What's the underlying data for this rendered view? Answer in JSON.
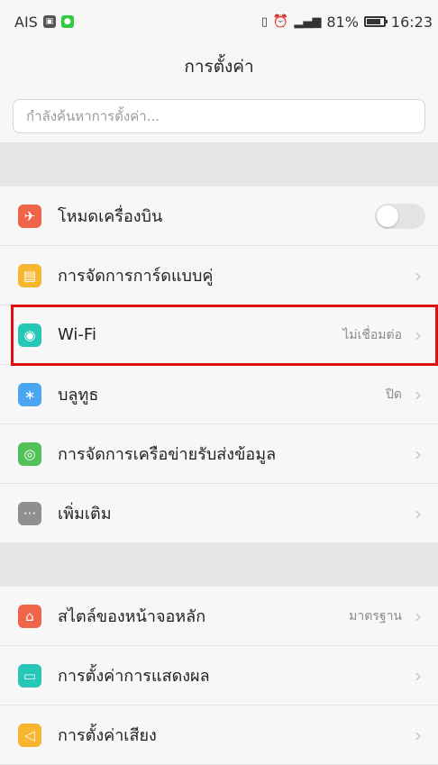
{
  "status": {
    "carrier": "AIS",
    "battery": "81%",
    "time": "16:23",
    "battery_fraction": 0.81
  },
  "header": {
    "title": "การตั้งค่า"
  },
  "search": {
    "placeholder": "กำลังค้นหาการตั้งค่า..."
  },
  "groups": [
    [
      {
        "name": "airplane",
        "label": "โหมดเครื่องบิน",
        "icon": "airplane-icon",
        "color": "#f0654a",
        "glyph": "✈",
        "toggle": true,
        "toggle_on": false
      },
      {
        "name": "dual-sim",
        "label": "การจัดการการ์ดแบบคู่",
        "icon": "sim-card-icon",
        "color": "#f6b630",
        "glyph": "▤",
        "chevron": true
      },
      {
        "name": "wifi",
        "label": "Wi-Fi",
        "value": "ไม่เชื่อมต่อ",
        "icon": "wifi-icon",
        "color": "#26c7b8",
        "glyph": "◉",
        "chevron": true
      },
      {
        "name": "bluetooth",
        "label": "บลูทูธ",
        "value": "ปิด",
        "icon": "bluetooth-icon",
        "color": "#4aa6f2",
        "glyph": "∗",
        "chevron": true
      },
      {
        "name": "mobile-network",
        "label": "การจัดการเครือข่ายรับส่งข้อมูล",
        "icon": "network-icon",
        "color": "#52c15a",
        "glyph": "◎",
        "chevron": true
      },
      {
        "name": "more",
        "label": "เพิ่มเติม",
        "icon": "more-icon",
        "color": "#8f8f8f",
        "glyph": "···",
        "chevron": true
      }
    ],
    [
      {
        "name": "home-style",
        "label": "สไตล์ของหน้าจอหลัก",
        "value": "มาตรฐาน",
        "icon": "home-icon",
        "color": "#f0654a",
        "glyph": "⌂",
        "chevron": true
      },
      {
        "name": "display",
        "label": "การตั้งค่าการแสดงผล",
        "icon": "display-icon",
        "color": "#26c7b8",
        "glyph": "▭",
        "chevron": true
      },
      {
        "name": "sound",
        "label": "การตั้งค่าเสียง",
        "icon": "sound-icon",
        "color": "#f6b630",
        "glyph": "◁",
        "chevron": true
      }
    ]
  ],
  "chevron_glyph": "›"
}
